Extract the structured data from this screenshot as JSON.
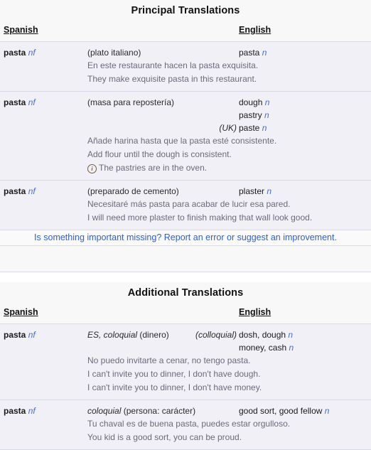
{
  "sections": [
    {
      "title": "Principal Translations",
      "headers": {
        "source": "Spanish",
        "target": "English"
      },
      "entries": [
        {
          "source_word": "pasta",
          "source_pos": "nf",
          "senses": [
            {
              "sense": "(plato italiano)",
              "tag": "",
              "target": "pasta",
              "target_pos": "n"
            }
          ],
          "examples": [
            {
              "icon": "",
              "text": "En este restaurante hacen la pasta exquisita."
            },
            {
              "icon": "",
              "text": "They make exquisite pasta in this restaurant."
            }
          ]
        },
        {
          "source_word": "pasta",
          "source_pos": "nf",
          "senses": [
            {
              "sense": "(masa para repostería)",
              "tag": "",
              "target": "dough",
              "target_pos": "n"
            },
            {
              "sense": "",
              "tag": "",
              "target": "pastry",
              "target_pos": "n"
            },
            {
              "sense": "",
              "tag": "(UK)",
              "target": "paste",
              "target_pos": "n"
            }
          ],
          "examples": [
            {
              "icon": "",
              "text": "Añade harina hasta que la pasta esté consistente."
            },
            {
              "icon": "",
              "text": "Add flour until the dough is consistent."
            },
            {
              "icon": "info-icon",
              "text": "The pastries are in the oven."
            }
          ]
        },
        {
          "source_word": "pasta",
          "source_pos": "nf",
          "senses": [
            {
              "sense": "(preparado de cemento)",
              "tag": "",
              "target": "plaster",
              "target_pos": "n"
            }
          ],
          "examples": [
            {
              "icon": "",
              "text": "Necesitaré más pasta para acabar de lucir esa pared."
            },
            {
              "icon": "",
              "text": "I will need more plaster to finish making that wall look good."
            }
          ]
        }
      ],
      "report_link": "Is something important missing? Report an error or suggest an improvement."
    },
    {
      "title": "Additional Translations",
      "headers": {
        "source": "Spanish",
        "target": "English"
      },
      "entries": [
        {
          "source_word": "pasta",
          "source_pos": "nf",
          "senses": [
            {
              "sense_reg": "ES, coloquial",
              "sense": "(dinero)",
              "tag": "(colloquial)",
              "target": "dosh, dough",
              "target_pos": "n"
            },
            {
              "sense_reg": "",
              "sense": "",
              "tag": "",
              "target": "money, cash",
              "target_pos": "n"
            }
          ],
          "examples": [
            {
              "icon": "",
              "text": "No puedo invitarte a cenar, no tengo pasta."
            },
            {
              "icon": "",
              "text": "I can't invite you to dinner, I don't have dough."
            },
            {
              "icon": "",
              "text": "I can't invite you to dinner, I don't have money."
            }
          ]
        },
        {
          "source_word": "pasta",
          "source_pos": "nf",
          "senses": [
            {
              "sense_reg": "coloquial",
              "sense": "(persona: carácter)",
              "tag": "",
              "target": "good sort, good fellow",
              "target_pos": "n"
            }
          ],
          "examples": [
            {
              "icon": "",
              "text": "Tu chaval es de buena pasta, puedes estar orgulloso."
            },
            {
              "icon": "",
              "text": "You kid is a good sort, you can be proud."
            }
          ]
        }
      ],
      "report_link": ""
    }
  ],
  "colors": {
    "row_bg": "#f1f0f6",
    "header_bg": "#f8f8f9",
    "link": "#2f5fce",
    "pos": "#4a6fc0",
    "example_text": "#6b6b78",
    "border": "#d9d9e3"
  }
}
